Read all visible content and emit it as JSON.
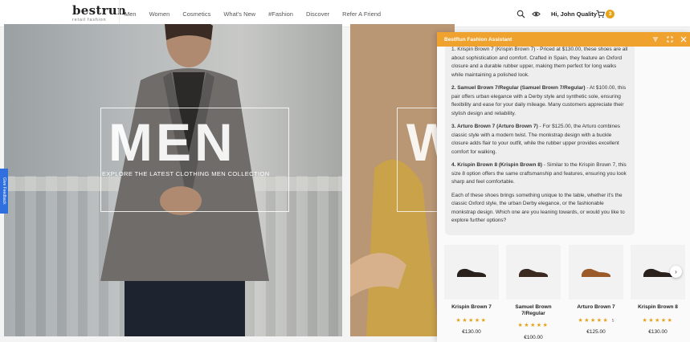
{
  "header": {
    "logo": "bestrun",
    "logo_sub": "retail fashion",
    "nav": [
      "Men",
      "Women",
      "Cosmetics",
      "What's New",
      "#Fashion",
      "Discover",
      "Refer A Friend"
    ],
    "greeting": "Hi, John Quality",
    "cart_count": "3",
    "icons": [
      "search-icon",
      "eye-icon",
      "cart-icon"
    ]
  },
  "hero": {
    "men_title": "MEN",
    "men_subtitle": "EXPLORE THE LATEST CLOTHING MEN COLLECTION",
    "women_letter": "W"
  },
  "feedback_tab": "Give Feedback",
  "assistant": {
    "title": "BestRun Fashion Assistant",
    "controls": [
      "filter-icon",
      "expand-icon",
      "close-icon"
    ],
    "message": {
      "p1_tail": "1. Krispin Brown 7 (Krispin Brown 7) - Priced at $130.00, these shoes are all about sophistication and comfort. Crafted in Spain, they feature an Oxford closure and a durable rubber upper, making them perfect for long walks while maintaining a polished look.",
      "p2_head": "2. Samuel Brown 7/Regular (Samuel Brown 7/Regular)",
      "p2_body": " - At $100.00, this pair offers urban elegance with a Derby style and synthetic sole, ensuring flexibility and ease for your daily mileage. Many customers appreciate their stylish design and reliability.",
      "p3_head": "3. Arturo Brown 7 (Arturo Brown 7)",
      "p3_body": " - For $125.00, the Arturo combines classic style with a modern twist. The monkstrap design with a buckle closure adds flair to your outfit, while the rubber upper provides excellent comfort for walking.",
      "p4_head": "4. Krispin Brown 8 (Krispin Brown 8)",
      "p4_body": " - Similar to the Krispin Brown 7, this size 8 option offers the same craftsmanship and features, ensuring you look sharp and feel comfortable.",
      "p5": "Each of these shoes brings something unique to the table, whether it's the classic Oxford style, the urban Derby elegance, or the fashionable monkstrap design. Which one are you leaning towards, or would you like to explore further options?"
    },
    "products": [
      {
        "name": "Krispin Brown 7",
        "stars": "★★★★★",
        "count": "",
        "price": "€130.00",
        "color": "#2a211c"
      },
      {
        "name": "Samuel Brown 7/Regular",
        "stars": "★★★★★",
        "count": "",
        "price": "€100.00",
        "color": "#3b2a20"
      },
      {
        "name": "Arturo Brown 7",
        "stars": "★★★★★",
        "count": "5",
        "price": "€125.00",
        "color": "#9a5a2a"
      },
      {
        "name": "Krispin Brown 8",
        "stars": "★★★★★",
        "count": "",
        "price": "€130.00",
        "color": "#2a211c"
      }
    ]
  }
}
